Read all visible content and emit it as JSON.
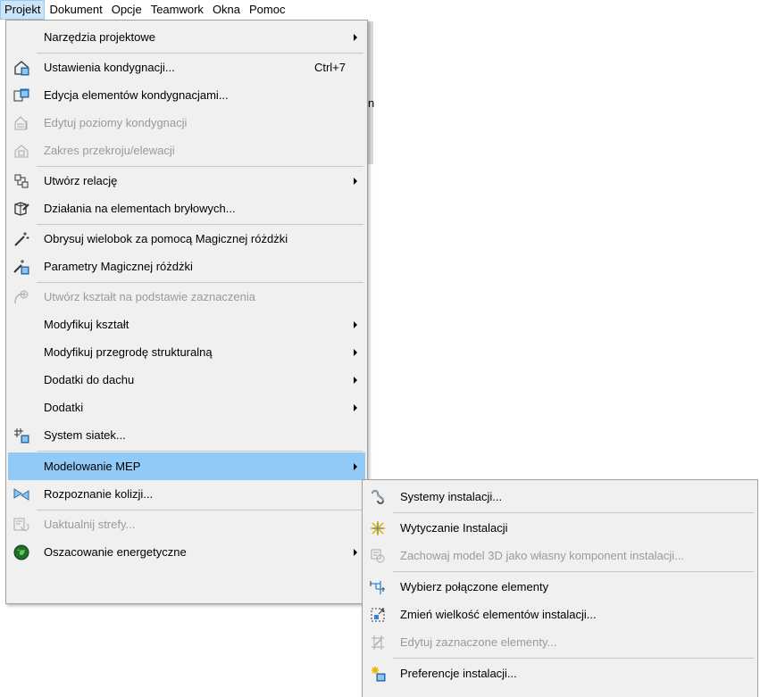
{
  "menubar": {
    "items": [
      "Projekt",
      "Dokument",
      "Opcje",
      "Teamwork",
      "Okna",
      "Pomoc"
    ]
  },
  "background": {
    "text": "n"
  },
  "main_menu": {
    "items": [
      {
        "label": "Narzędzia projektowe",
        "icon": "none",
        "submenu": true
      },
      {
        "label": "Ustawienia kondygnacji...",
        "shortcut": "Ctrl+7",
        "icon": "story-settings-icon"
      },
      {
        "label": "Edycja elementów kondygnacjami...",
        "icon": "edit-by-story-icon"
      },
      {
        "label": "Edytuj poziomy kondygnacji",
        "icon": "story-levels-icon",
        "disabled": true
      },
      {
        "label": "Zakres przekroju/elewacji",
        "icon": "section-range-icon",
        "disabled": true
      },
      {
        "label": "Utwórz relację",
        "icon": "relation-icon",
        "submenu": true
      },
      {
        "label": "Działania na elementach bryłowych...",
        "icon": "solid-operations-icon"
      },
      {
        "label": "Obrysuj wielobok za pomocą Magicznej różdżki",
        "icon": "magic-wand-icon"
      },
      {
        "label": "Parametry Magicznej różdżki",
        "icon": "magic-wand-settings-icon"
      },
      {
        "label": "Utwórz kształt na podstawie zaznaczenia",
        "icon": "create-shape-icon",
        "disabled": true
      },
      {
        "label": "Modyfikuj kształt",
        "icon": "none",
        "submenu": true
      },
      {
        "label": "Modyfikuj przegrodę strukturalną",
        "icon": "none",
        "submenu": true
      },
      {
        "label": "Dodatki do dachu",
        "icon": "none",
        "submenu": true
      },
      {
        "label": "Dodatki",
        "icon": "none",
        "submenu": true
      },
      {
        "label": "System siatek...",
        "icon": "grid-system-icon"
      },
      {
        "label": "Modelowanie MEP",
        "icon": "none",
        "submenu": true,
        "highlighted": true
      },
      {
        "label": "Rozpoznanie kolizji...",
        "icon": "collision-detection-icon"
      },
      {
        "label": "Uaktualnij strefy",
        "icon": "update-zones-icon",
        "disabled": true,
        "suffix": "..."
      },
      {
        "label": "Oszacowanie energetyczne",
        "icon": "energy-globe-icon",
        "submenu": true
      }
    ]
  },
  "sub_menu": {
    "items": [
      {
        "label": "Systemy instalacji...",
        "icon": "mep-systems-icon"
      },
      {
        "label": "Wytyczanie Instalacji",
        "icon": "routing-icon"
      },
      {
        "label": "Zachowaj model 3D jako własny komponent instalacji...",
        "icon": "save-3d-icon",
        "disabled": true
      },
      {
        "label": "Wybierz połączone elementy",
        "icon": "select-connected-icon"
      },
      {
        "label": "Zmień wielkość elementów instalacji...",
        "icon": "resize-elements-icon"
      },
      {
        "label": "Edytuj zaznaczone elementy...",
        "icon": "edit-selected-icon",
        "disabled": true
      },
      {
        "label": "Preferencje instalacji...",
        "icon": "mep-preferences-icon"
      }
    ]
  },
  "colors": {
    "menu_bg": "#f0f0f0",
    "highlight": "#91c9f7",
    "active_menubar": "#cce4f7",
    "disabled_text": "#9a9a9a"
  }
}
